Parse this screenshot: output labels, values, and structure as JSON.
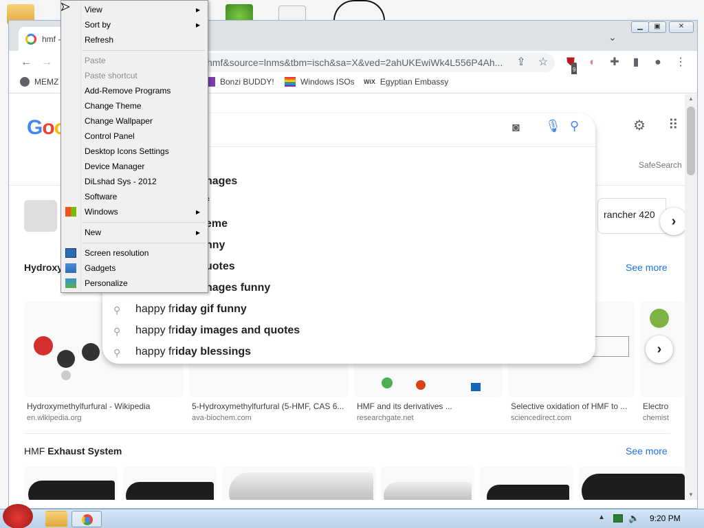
{
  "browser": {
    "tab_title": "hmf -",
    "address": "hmf&source=lnms&tbm=isch&sa=X&ved=2ahUKEwiWk4L556P4Ah...",
    "bookmarks": [
      "MEMZ",
      "Bonzi BUDDY!",
      "Windows ISOs",
      "Egyptian Embassy"
    ],
    "extension_badge": "9"
  },
  "google": {
    "logo": "Goo",
    "safesearch": "SafeSearch",
    "suggestions": [
      {
        "prefix": "",
        "rest": "nages"
      },
      {
        "prefix": "",
        "rest": "f"
      },
      {
        "prefix": "",
        "rest": "eme"
      },
      {
        "prefix": "",
        "rest": "nny"
      },
      {
        "prefix": "",
        "rest": "uotes"
      },
      {
        "prefix": "",
        "rest": "nages funny"
      },
      {
        "prefix": "happy fr",
        "rest": "iday gif funny"
      },
      {
        "prefix": "happy fr",
        "rest": "iday images and quotes"
      },
      {
        "prefix": "happy fr",
        "rest": "iday blessings"
      }
    ],
    "chip_right": "rancher 420",
    "section1": {
      "title": "Hydroxy",
      "see_more": "See more"
    },
    "results": [
      {
        "caption": "Hydroxymethylfurfural - Wikipedia",
        "source": "en.wikipedia.org"
      },
      {
        "caption": "5-Hydroxymethylfurfural (5-HMF, CAS 6...",
        "source": "ava-biochem.com"
      },
      {
        "caption": "HMF and its derivatives ...",
        "source": "researchgate.net"
      },
      {
        "caption": "Selective oxidation of HMF to ...",
        "source": "sciencedirect.com"
      },
      {
        "caption": "Electro",
        "source": "chemist"
      }
    ],
    "section2": {
      "title_prefix": "HMF ",
      "title_bold": "Exhaust System",
      "see_more": "See more"
    }
  },
  "context_menu": {
    "items": [
      "View",
      "Sort by",
      "Refresh",
      "Paste",
      "Paste shortcut",
      "Add-Remove Programs",
      "Change Theme",
      "Change Wallpaper",
      "Control Panel",
      "Desktop Icons Settings",
      "Device Manager",
      "DiLshad Sys - 2012",
      "Software",
      "Windows",
      "New",
      "Screen resolution",
      "Gadgets",
      "Personalize"
    ]
  },
  "taskbar": {
    "clock": "9:20 PM"
  }
}
